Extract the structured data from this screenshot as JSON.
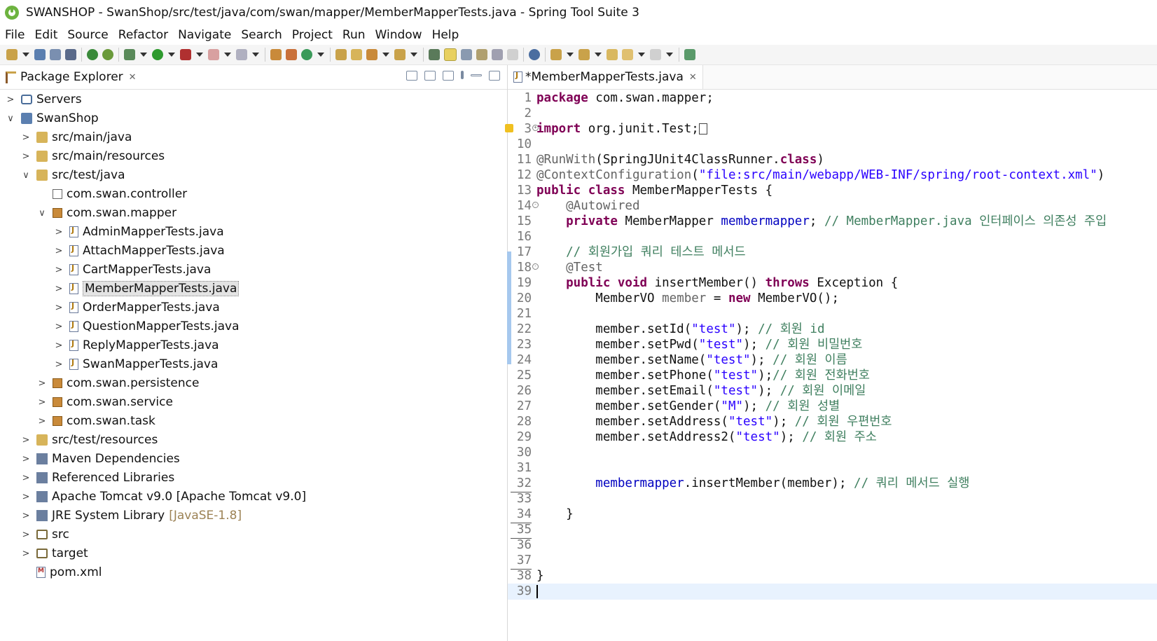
{
  "window": {
    "title": "SWANSHOP - SwanShop/src/test/java/com/swan/mapper/MemberMapperTests.java - Spring Tool Suite 3"
  },
  "menu": [
    "File",
    "Edit",
    "Source",
    "Refactor",
    "Navigate",
    "Search",
    "Project",
    "Run",
    "Window",
    "Help"
  ],
  "package_explorer": {
    "title": "Package Explorer",
    "items": [
      {
        "label": "Servers"
      },
      {
        "label": "SwanShop"
      },
      {
        "label": "src/main/java"
      },
      {
        "label": "src/main/resources"
      },
      {
        "label": "src/test/java"
      },
      {
        "label": "com.swan.controller"
      },
      {
        "label": "com.swan.mapper"
      },
      {
        "label": "AdminMapperTests.java"
      },
      {
        "label": "AttachMapperTests.java"
      },
      {
        "label": "CartMapperTests.java"
      },
      {
        "label": "MemberMapperTests.java"
      },
      {
        "label": "OrderMapperTests.java"
      },
      {
        "label": "QuestionMapperTests.java"
      },
      {
        "label": "ReplyMapperTests.java"
      },
      {
        "label": "SwanMapperTests.java"
      },
      {
        "label": "com.swan.persistence"
      },
      {
        "label": "com.swan.service"
      },
      {
        "label": "com.swan.task"
      },
      {
        "label": "src/test/resources"
      },
      {
        "label": "Maven Dependencies"
      },
      {
        "label": "Referenced Libraries"
      },
      {
        "label": "Apache Tomcat v9.0 [Apache Tomcat v9.0]"
      },
      {
        "label": "JRE System Library",
        "suffix": "[JavaSE-1.8]"
      },
      {
        "label": "src"
      },
      {
        "label": "target"
      },
      {
        "label": "pom.xml"
      }
    ]
  },
  "editor": {
    "tab_label": "*MemberMapperTests.java",
    "line_numbers": [
      "1",
      "2",
      "3",
      "10",
      "11",
      "12",
      "13",
      "14",
      "15",
      "16",
      "17",
      "18",
      "19",
      "20",
      "21",
      "22",
      "23",
      "24",
      "25",
      "26",
      "27",
      "28",
      "29",
      "30",
      "31",
      "32",
      "33",
      "34",
      "35",
      "36",
      "37",
      "38",
      "39"
    ],
    "code": {
      "l1_kw": "package",
      "l1_rest": " com.swan.mapper;",
      "l3_kw": "import",
      "l3_rest": " org.junit.Test;",
      "l11_an": "@RunWith",
      "l11_a": "(SpringJUnit4ClassRunner.",
      "l11_kw": "class",
      "l11_b": ")",
      "l12_an": "@ContextConfiguration",
      "l12_a": "(",
      "l12_st": "\"file:src/main/webapp/WEB-INF/spring/root-context.xml\"",
      "l12_b": ")",
      "l13_kw": "public class",
      "l13_rest": " MemberMapperTests {",
      "l14_an": "    @Autowired",
      "l15_kw": "    private",
      "l15_a": " MemberMapper ",
      "l15_fd": "membermapper",
      "l15_b": "; ",
      "l15_cm": "// MemberMapper.java 인터페이스 의존성 주입",
      "l17_cm": "    // 회원가입 쿼리 테스트 메서드",
      "l18_an": "    @Test",
      "l19_kw1": "    public void",
      "l19_a": " insertMember() ",
      "l19_kw2": "throws",
      "l19_b": " Exception {",
      "l20_a": "        MemberVO ",
      "l20_v": "member",
      "l20_b": " = ",
      "l20_kw": "new",
      "l20_c": " MemberVO();",
      "l22_a": "        member.setId(",
      "l22_st": "\"test\"",
      "l22_b": "); ",
      "l22_cm": "// 회원 id",
      "l23_a": "        member.setPwd(",
      "l23_st": "\"test\"",
      "l23_b": "); ",
      "l23_cm": "// 회원 비밀번호",
      "l24_a": "        member.setName(",
      "l24_st": "\"test\"",
      "l24_b": "); ",
      "l24_cm": "// 회원 이름",
      "l25_a": "        member.setPhone(",
      "l25_st": "\"test\"",
      "l25_b": ");",
      "l25_cm": "// 회원 전화번호",
      "l26_a": "        member.setEmail(",
      "l26_st": "\"test\"",
      "l26_b": "); ",
      "l26_cm": "// 회원 이메일",
      "l27_a": "        member.setGender(",
      "l27_st": "\"M\"",
      "l27_b": "); ",
      "l27_cm": "// 회원 성별",
      "l28_a": "        member.setAddress(",
      "l28_st": "\"test\"",
      "l28_b": "); ",
      "l28_cm": "// 회원 우편번호",
      "l29_a": "        member.setAddress2(",
      "l29_st": "\"test\"",
      "l29_b": "); ",
      "l29_cm": "// 회원 주소",
      "l32_fd": "        membermapper",
      "l32_a": ".insertMember(member); ",
      "l32_cm": "// 쿼리 메서드 실행",
      "l34": "    }",
      "l38": "}"
    }
  }
}
